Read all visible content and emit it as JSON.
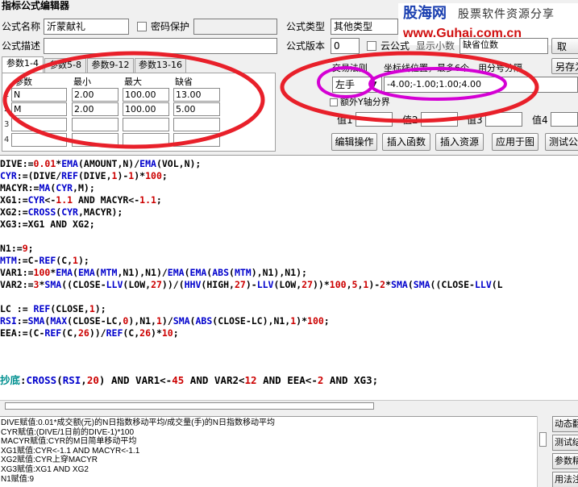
{
  "window": {
    "title": "指标公式编辑器"
  },
  "watermark": {
    "brand_cn": "股海网",
    "brand_sub": "股票软件资源分享",
    "url": "www.Guhai.com.cn"
  },
  "form": {
    "name_label": "公式名称",
    "name_value": "沂蒙献礼",
    "password_label": "密码保护",
    "type_label": "公式类型",
    "type_value": "其他类型",
    "desc_label": "公式描述",
    "version_label": "公式版本",
    "version_value": "0",
    "cloud_label": "云公式",
    "cloud_more": "显示小数",
    "cloud_select_value": "缺省位数"
  },
  "buttons": {
    "cancel": "取",
    "save_as": "另存为",
    "edit_ops": "编辑操作",
    "insert_func": "插入函数",
    "insert_res": "插入资源",
    "apply": "应用于图",
    "test": "测试公"
  },
  "params": {
    "tabs": [
      "参数1-4",
      "参数5-8",
      "参数9-12",
      "参数13-16"
    ],
    "headers": [
      "参数",
      "最小",
      "最大",
      "缺省"
    ],
    "rows": [
      {
        "n": "1",
        "name": "N",
        "min": "2.00",
        "max": "100.00",
        "def": "13.00"
      },
      {
        "n": "2",
        "name": "M",
        "min": "2.00",
        "max": "100.00",
        "def": "5.00"
      },
      {
        "n": "3",
        "name": "",
        "min": "",
        "max": "",
        "def": ""
      },
      {
        "n": "4",
        "name": "",
        "min": "",
        "max": "",
        "def": ""
      }
    ]
  },
  "axis": {
    "trade_method_label": "交易法则",
    "coords_label": "坐标线位置，最多6个，用分号分隔",
    "hand_value": "左手",
    "coords_value": "-4.00;-1.00;1.00;4.00",
    "extra_axis_label": "额外Y轴分界",
    "val_labels": [
      "值1",
      "值2",
      "值3",
      "值4"
    ]
  },
  "code": [
    [
      [
        "DIVE:=",
        "b"
      ],
      [
        "0.01",
        "r"
      ],
      [
        "*",
        "b"
      ],
      [
        "EMA",
        "f"
      ],
      [
        "(",
        "b"
      ],
      [
        "AMOUNT",
        "b"
      ],
      [
        ",N)/",
        "b"
      ],
      [
        "EMA",
        "f"
      ],
      [
        "(",
        "b"
      ],
      [
        "VOL",
        "b"
      ],
      [
        ",N);",
        "b"
      ]
    ],
    [
      [
        "CYR",
        "f"
      ],
      [
        ":=(DIVE/",
        "b"
      ],
      [
        "REF",
        "f"
      ],
      [
        "(DIVE,",
        "b"
      ],
      [
        "1",
        "r"
      ],
      [
        ")-",
        "b"
      ],
      [
        "1",
        "r"
      ],
      [
        ")*",
        "b"
      ],
      [
        "100",
        "r"
      ],
      [
        ";",
        "b"
      ]
    ],
    [
      [
        "MACYR:=",
        "b"
      ],
      [
        "MA",
        "f"
      ],
      [
        "(",
        "b"
      ],
      [
        "CYR",
        "f"
      ],
      [
        ",M);",
        "b"
      ]
    ],
    [
      [
        "XG1:=",
        "b"
      ],
      [
        "CYR",
        "f"
      ],
      [
        "<-",
        "b"
      ],
      [
        "1.1",
        "r"
      ],
      [
        " AND ",
        "b"
      ],
      [
        "MACYR<-",
        "b"
      ],
      [
        "1.1",
        "r"
      ],
      [
        ";",
        "b"
      ]
    ],
    [
      [
        "XG2:=",
        "b"
      ],
      [
        "CROSS",
        "f"
      ],
      [
        "(",
        "b"
      ],
      [
        "CYR",
        "f"
      ],
      [
        ",MACYR);",
        "b"
      ]
    ],
    [
      [
        "XG3:=XG1 AND XG2;",
        "b"
      ]
    ],
    [],
    [
      [
        "N1:=",
        "b"
      ],
      [
        "9",
        "r"
      ],
      [
        ";",
        "b"
      ]
    ],
    [
      [
        "MTM",
        "f"
      ],
      [
        ":=C-",
        "b"
      ],
      [
        "REF",
        "f"
      ],
      [
        "(C,",
        "b"
      ],
      [
        "1",
        "r"
      ],
      [
        ");",
        "b"
      ]
    ],
    [
      [
        "VAR1:=",
        "b"
      ],
      [
        "100",
        "r"
      ],
      [
        "*",
        "b"
      ],
      [
        "EMA",
        "f"
      ],
      [
        "(",
        "b"
      ],
      [
        "EMA",
        "f"
      ],
      [
        "(",
        "b"
      ],
      [
        "MTM",
        "f"
      ],
      [
        ",N1),N1)/",
        "b"
      ],
      [
        "EMA",
        "f"
      ],
      [
        "(",
        "b"
      ],
      [
        "EMA",
        "f"
      ],
      [
        "(",
        "b"
      ],
      [
        "ABS",
        "f"
      ],
      [
        "(",
        "b"
      ],
      [
        "MTM",
        "f"
      ],
      [
        "),N1),N1);",
        "b"
      ]
    ],
    [
      [
        "VAR2:=",
        "b"
      ],
      [
        "3",
        "r"
      ],
      [
        "*",
        "b"
      ],
      [
        "SMA",
        "f"
      ],
      [
        "((",
        "b"
      ],
      [
        "CLOSE",
        "b"
      ],
      [
        "-",
        "b"
      ],
      [
        "LLV",
        "f"
      ],
      [
        "(",
        "b"
      ],
      [
        "LOW",
        "b"
      ],
      [
        ",",
        "b"
      ],
      [
        "27",
        "r"
      ],
      [
        "))/(",
        "b"
      ],
      [
        "HHV",
        "f"
      ],
      [
        "(",
        "b"
      ],
      [
        "HIGH",
        "b"
      ],
      [
        ",",
        "b"
      ],
      [
        "27",
        "r"
      ],
      [
        ")-",
        "b"
      ],
      [
        "LLV",
        "f"
      ],
      [
        "(",
        "b"
      ],
      [
        "LOW",
        "b"
      ],
      [
        ",",
        "b"
      ],
      [
        "27",
        "r"
      ],
      [
        "))*",
        "b"
      ],
      [
        "100",
        "r"
      ],
      [
        ",",
        "b"
      ],
      [
        "5",
        "r"
      ],
      [
        ",",
        "b"
      ],
      [
        "1",
        "r"
      ],
      [
        ")-",
        "b"
      ],
      [
        "2",
        "r"
      ],
      [
        "*",
        "b"
      ],
      [
        "SMA",
        "f"
      ],
      [
        "(",
        "b"
      ],
      [
        "SMA",
        "f"
      ],
      [
        "((",
        "b"
      ],
      [
        "CLOSE",
        "b"
      ],
      [
        "-",
        "b"
      ],
      [
        "LLV",
        "f"
      ],
      [
        "(L",
        "b"
      ]
    ],
    [],
    [
      [
        "LC := ",
        "b"
      ],
      [
        "REF",
        "f"
      ],
      [
        "(",
        "b"
      ],
      [
        "CLOSE",
        "b"
      ],
      [
        ",",
        "b"
      ],
      [
        "1",
        "r"
      ],
      [
        ");",
        "b"
      ]
    ],
    [
      [
        "RSI",
        "f"
      ],
      [
        ":=",
        "b"
      ],
      [
        "SMA",
        "f"
      ],
      [
        "(",
        "b"
      ],
      [
        "MAX",
        "f"
      ],
      [
        "(",
        "b"
      ],
      [
        "CLOSE",
        "b"
      ],
      [
        "-LC,",
        "b"
      ],
      [
        "0",
        "r"
      ],
      [
        "),N1,",
        "b"
      ],
      [
        "1",
        "r"
      ],
      [
        ")/",
        "b"
      ],
      [
        "SMA",
        "f"
      ],
      [
        "(",
        "b"
      ],
      [
        "ABS",
        "f"
      ],
      [
        "(",
        "b"
      ],
      [
        "CLOSE",
        "b"
      ],
      [
        "-LC),N1,",
        "b"
      ],
      [
        "1",
        "r"
      ],
      [
        ")*",
        "b"
      ],
      [
        "100",
        "r"
      ],
      [
        ";",
        "b"
      ]
    ],
    [
      [
        "EEA:=(C-",
        "b"
      ],
      [
        "REF",
        "f"
      ],
      [
        "(C,",
        "b"
      ],
      [
        "26",
        "r"
      ],
      [
        "))/",
        "b"
      ],
      [
        "REF",
        "f"
      ],
      [
        "(C,",
        "b"
      ],
      [
        "26",
        "r"
      ],
      [
        ")*",
        "b"
      ],
      [
        "10",
        "r"
      ],
      [
        ";",
        "b"
      ]
    ],
    [],
    [],
    [
      [
        "抄底",
        "s"
      ],
      [
        ":",
        "b"
      ],
      [
        "CROSS",
        "f"
      ],
      [
        "(",
        "b"
      ],
      [
        "RSI",
        "f"
      ],
      [
        ",",
        "b"
      ],
      [
        "20",
        "r"
      ],
      [
        ") AND VAR1<-",
        "b"
      ],
      [
        "45",
        "r"
      ],
      [
        " AND VAR2<",
        "b"
      ],
      [
        "12",
        "r"
      ],
      [
        " AND EEA<-",
        "b"
      ],
      [
        "2",
        "r"
      ],
      [
        " AND XG3;",
        "b"
      ]
    ]
  ],
  "annotations": [
    "DIVE赋值:0.01*成交额(元)的N日指数移动平均/成交量(手)的N日指数移动平均",
    "CYR赋值:(DIVE/1日前的DIVE-1)*100",
    "MACYR赋值:CYR的M日简单移动平均",
    "XG1赋值:CYR<-1.1 AND MACYR<-1.1",
    "XG2赋值:CYR上穿MACYR",
    "XG3赋值:XG1 AND XG2",
    "N1赋值:9"
  ],
  "side_buttons": [
    "动态翻",
    "测试结",
    "参数精",
    "用法注"
  ],
  "colors": {
    "circle_red": "#e8202a",
    "circle_magenta": "#d400d4"
  }
}
